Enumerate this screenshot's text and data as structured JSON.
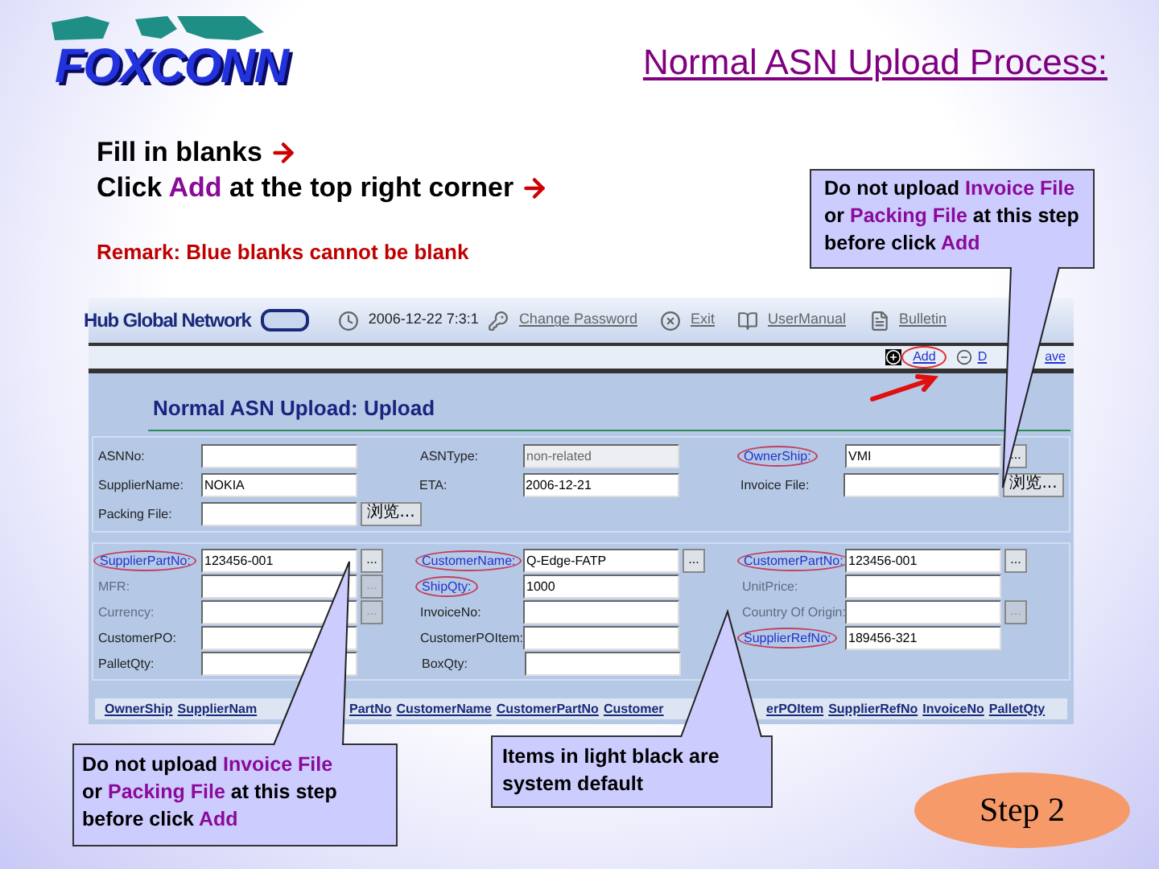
{
  "logo": {
    "text": "FOXCONN"
  },
  "title": "Normal ASN Upload Process:",
  "instructions": [
    {
      "arrow": true,
      "segments": [
        {
          "text": "Fill in blanks",
          "kind": "plain"
        }
      ]
    },
    {
      "arrow": true,
      "segments": [
        {
          "text": "Click ",
          "kind": "plain"
        },
        {
          "text": "Add",
          "kind": "highlight"
        },
        {
          "text": " at the top right corner",
          "kind": "plain"
        }
      ]
    }
  ],
  "remark": "Remark: Blue blanks cannot be blank",
  "callouts": [
    {
      "lines": [
        [
          {
            "text": "Do not upload ",
            "kind": "plain"
          },
          {
            "text": "Invoice File",
            "kind": "highlight"
          }
        ],
        [
          {
            "text": "or ",
            "kind": "plain"
          },
          {
            "text": "Packing File",
            "kind": "highlight"
          },
          {
            "text": " at this step",
            "kind": "plain"
          }
        ],
        [
          {
            "text": "before click ",
            "kind": "plain"
          },
          {
            "text": "Add",
            "kind": "highlight"
          }
        ]
      ]
    },
    {
      "lines": [
        [
          {
            "text": "Do not upload ",
            "kind": "plain"
          },
          {
            "text": "Invoice File",
            "kind": "highlight"
          }
        ],
        [
          {
            "text": "or ",
            "kind": "plain"
          },
          {
            "text": "Packing File",
            "kind": "highlight"
          },
          {
            "text": " at this step",
            "kind": "plain"
          }
        ],
        [
          {
            "text": "before click ",
            "kind": "plain"
          },
          {
            "text": "Add",
            "kind": "highlight"
          }
        ]
      ]
    },
    {
      "lines": [
        [
          {
            "text": "Items in light black are",
            "kind": "plain"
          }
        ],
        [
          {
            "text": "system default",
            "kind": "plain"
          }
        ]
      ]
    }
  ],
  "app": {
    "brand": "Hub Global Network",
    "datetime": "2006-12-22 7:3:1",
    "links": [
      {
        "label": "Change Password"
      },
      {
        "label": "Exit"
      },
      {
        "label": "UserManual"
      },
      {
        "label": "Bulletin"
      }
    ],
    "actions": [
      {
        "label": "Add",
        "kind": "action",
        "highlighted": true
      },
      {
        "label": "D",
        "kind": "action",
        "highlighted": false
      },
      {
        "label": "ave",
        "kind": "fragment",
        "highlighted": false
      }
    ],
    "page_title": "Normal ASN Upload: Upload",
    "sections": [
      {
        "rows": [
          [
            {
              "label": "ASNNo:",
              "kind": "normal",
              "readonly": false
            },
            {
              "label": "ASNType:",
              "kind": "normal",
              "value": "non-related",
              "readonly": true
            },
            {
              "label": "OwnerShip:",
              "kind": "required",
              "value": "VMI",
              "readonly": false,
              "button": {
                "label": "...",
                "kind": "lookup",
                "disabled": false
              }
            }
          ],
          [
            {
              "label": "SupplierName:",
              "kind": "normal",
              "value": "NOKIA",
              "readonly": false
            },
            {
              "label": "ETA:",
              "kind": "normal",
              "value": "2006-12-21",
              "readonly": false
            },
            {
              "label": "Invoice File:",
              "kind": "normal",
              "readonly": false,
              "button": {
                "label": "浏览...",
                "kind": "browse",
                "disabled": false
              }
            }
          ],
          [
            {
              "label": "Packing File:",
              "kind": "normal",
              "readonly": false,
              "button": {
                "label": "浏览...",
                "kind": "browse",
                "disabled": false
              }
            }
          ]
        ]
      },
      {
        "rows": [
          [
            {
              "label": "SupplierPartNo:",
              "kind": "required",
              "value": "123456-001",
              "readonly": false,
              "button": {
                "label": "...",
                "kind": "lookup",
                "disabled": false
              }
            },
            {
              "label": "CustomerName:",
              "kind": "required",
              "value": "Q-Edge-FATP",
              "readonly": false,
              "button": {
                "label": "...",
                "kind": "lookup",
                "disabled": false
              }
            },
            {
              "label": "CustomerPartNo:",
              "kind": "required",
              "value": "123456-001",
              "readonly": false,
              "button": {
                "label": "...",
                "kind": "lookup",
                "disabled": false
              }
            }
          ],
          [
            {
              "label": "MFR:",
              "kind": "system",
              "readonly": false,
              "button": {
                "label": "...",
                "kind": "lookup",
                "disabled": true
              }
            },
            {
              "label": "ShipQty:",
              "kind": "required",
              "value": "1000",
              "readonly": false
            },
            {
              "label": "UnitPrice:",
              "kind": "system",
              "readonly": false
            }
          ],
          [
            {
              "label": "Currency:",
              "kind": "system",
              "readonly": false,
              "button": {
                "label": "...",
                "kind": "lookup",
                "disabled": true
              }
            },
            {
              "label": "InvoiceNo:",
              "kind": "normal",
              "readonly": false
            },
            {
              "label": "Country Of Origin:",
              "kind": "system",
              "readonly": false,
              "button": {
                "label": "...",
                "kind": "lookup",
                "disabled": true
              }
            }
          ],
          [
            {
              "label": "CustomerPO:",
              "kind": "normal",
              "readonly": false
            },
            {
              "label": "CustomerPOItem:",
              "kind": "normal",
              "readonly": false
            },
            {
              "label": "SupplierRefNo:",
              "kind": "required",
              "value": "189456-321",
              "readonly": false
            }
          ],
          [
            {
              "label": "PalletQty:",
              "kind": "normal",
              "readonly": false
            },
            {
              "label": "BoxQty:",
              "kind": "normal",
              "readonly": false
            }
          ]
        ]
      }
    ],
    "grid_header": [
      [
        "OwnerShip",
        "SupplierNam"
      ],
      [
        "PartNo",
        "CustomerName",
        "CustomerPartNo",
        "Customer"
      ],
      [
        "erPOItem",
        "SupplierRefNo",
        "InvoiceNo",
        "PalletQty"
      ]
    ]
  },
  "step": "Step 2"
}
